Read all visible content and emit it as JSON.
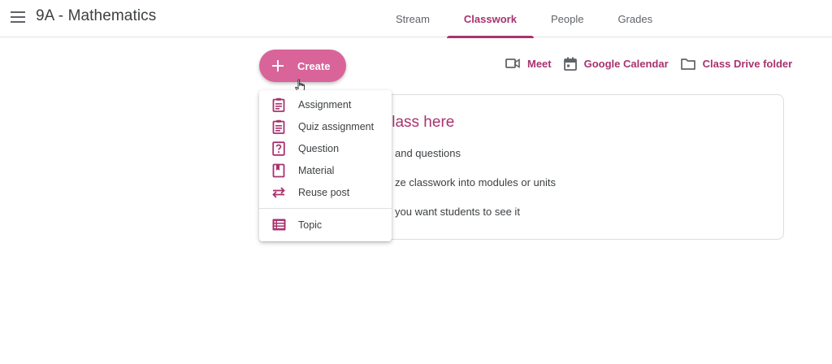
{
  "header": {
    "class_title": "9A - Mathematics",
    "menu_icon": "hamburger-menu-icon",
    "tabs": [
      {
        "label": "Stream",
        "active": false
      },
      {
        "label": "Classwork",
        "active": true
      },
      {
        "label": "People",
        "active": false
      },
      {
        "label": "Grades",
        "active": false
      }
    ]
  },
  "toolbar": {
    "create_label": "Create",
    "links": [
      {
        "label": "Meet",
        "icon": "video-camera-icon"
      },
      {
        "label": "Google Calendar",
        "icon": "calendar-icon"
      },
      {
        "label": "Class Drive folder",
        "icon": "folder-icon"
      }
    ]
  },
  "create_menu": {
    "items": [
      {
        "label": "Assignment",
        "icon": "assignment-icon"
      },
      {
        "label": "Quiz assignment",
        "icon": "quiz-assignment-icon"
      },
      {
        "label": "Question",
        "icon": "question-icon"
      },
      {
        "label": "Material",
        "icon": "material-icon"
      },
      {
        "label": "Reuse post",
        "icon": "reuse-post-icon"
      }
    ],
    "topic": {
      "label": "Topic",
      "icon": "topic-icon"
    }
  },
  "info_card": {
    "title": "our class here",
    "lines": [
      "and questions",
      "ze classwork into modules or units",
      "you want students to see it"
    ]
  },
  "colors": {
    "accent": "#a8326f",
    "create_button": "#d9649a"
  }
}
